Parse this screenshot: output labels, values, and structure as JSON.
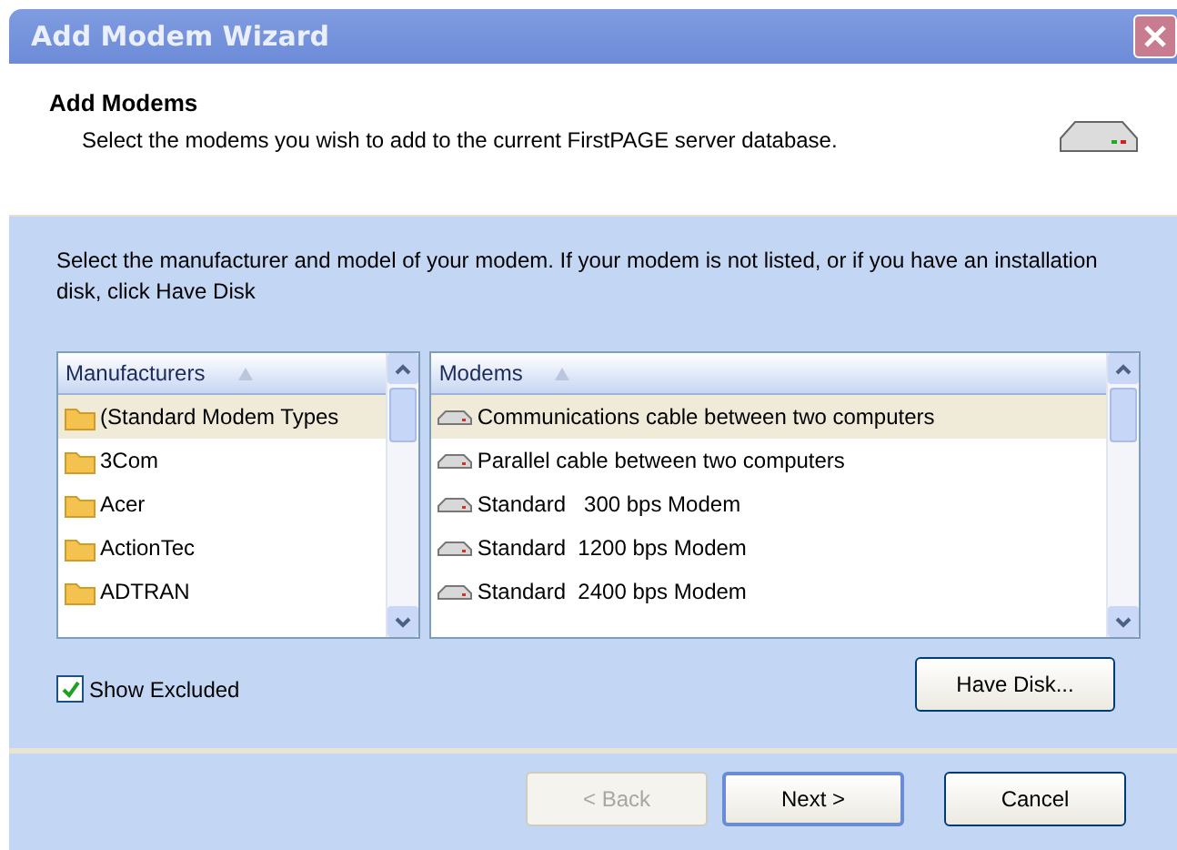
{
  "window": {
    "title": "Add Modem Wizard"
  },
  "header": {
    "title": "Add Modems",
    "subtitle": "Select the modems you wish to add to the current FirstPAGE server database."
  },
  "instructions": "Select the manufacturer and model of your modem. If your modem is not listed, or if you have an installation disk, click Have Disk",
  "manufacturers": {
    "column": "Manufacturers",
    "items": [
      {
        "label": "(Standard Modem Types",
        "selected": true
      },
      {
        "label": "3Com",
        "selected": false
      },
      {
        "label": "Acer",
        "selected": false
      },
      {
        "label": "ActionTec",
        "selected": false
      },
      {
        "label": "ADTRAN",
        "selected": false
      }
    ]
  },
  "modems": {
    "column": "Modems",
    "items": [
      {
        "label": "Communications cable between two computers",
        "selected": true
      },
      {
        "label": "Parallel cable between two computers",
        "selected": false
      },
      {
        "label": "Standard   300 bps Modem",
        "selected": false
      },
      {
        "label": "Standard  1200 bps Modem",
        "selected": false
      },
      {
        "label": "Standard  2400 bps Modem",
        "selected": false
      }
    ]
  },
  "show_excluded": {
    "label": "Show Excluded",
    "checked": true
  },
  "have_disk": {
    "label": "Have Disk..."
  },
  "buttons": [
    {
      "label": "< Back",
      "disabled": true,
      "default": false
    },
    {
      "label": "Next >",
      "disabled": false,
      "default": true
    },
    {
      "label": "Cancel",
      "disabled": false,
      "default": false
    }
  ]
}
